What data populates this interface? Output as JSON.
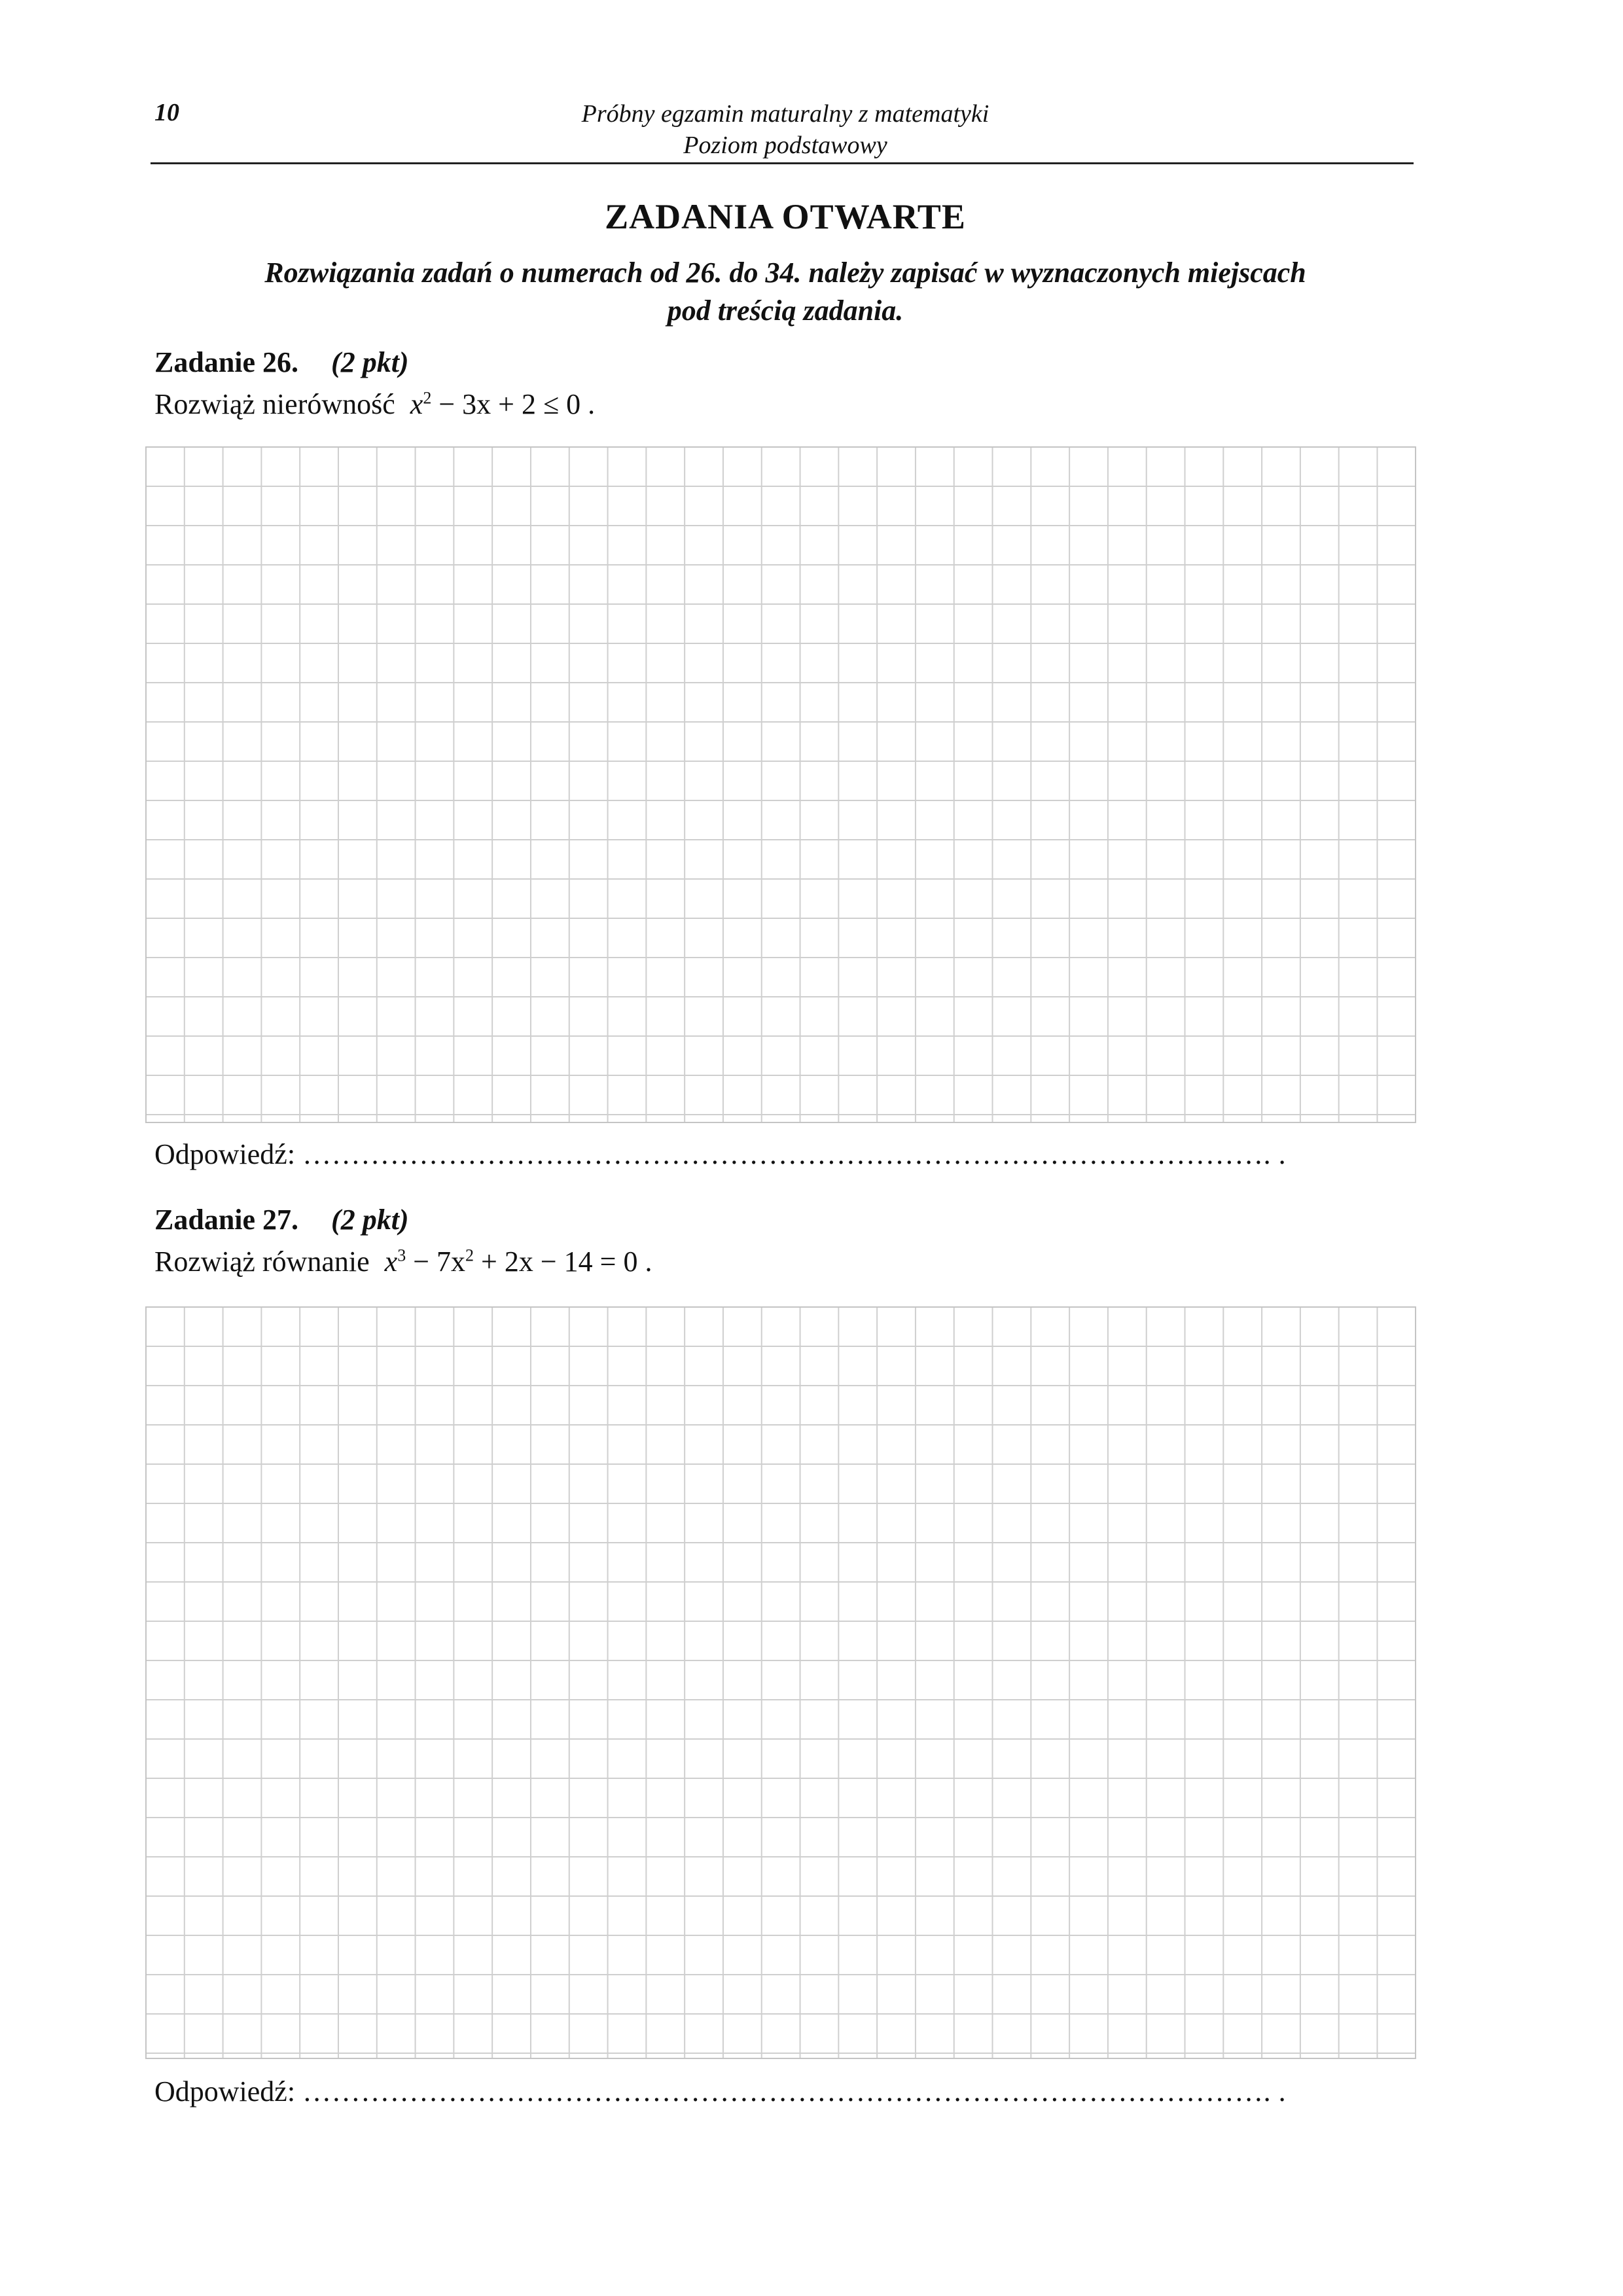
{
  "header": {
    "page_number": "10",
    "title_line1": "Próbny egzamin maturalny z matematyki",
    "title_line2": "Poziom podstawowy"
  },
  "section": {
    "title": "ZADANIA OTWARTE",
    "instructions_line1": "Rozwiązania zadań o numerach od 26. do 34. należy zapisać w wyznaczonych miejscach",
    "instructions_line2": "pod treścią zadania."
  },
  "tasks": [
    {
      "label": "Zadanie 26.",
      "points": "(2 pkt)",
      "prompt": "Rozwiąż nierówność",
      "math_var": "x",
      "math_exp": "2",
      "math_rest": " − 3x + 2 ≤ 0 .",
      "answer_label": "Odpowiedź:",
      "answer_dots": "………………………………………………………………………………………. ."
    },
    {
      "label": "Zadanie 27.",
      "points": "(2 pkt)",
      "prompt": "Rozwiąż równanie",
      "math_var": "x",
      "math_exp": "3",
      "math_mid": " − 7x",
      "math_exp2": "2",
      "math_rest": " + 2x − 14 = 0 .",
      "answer_label": "Odpowiedź:",
      "answer_dots": "………………………………………………………………………………………. ."
    }
  ]
}
